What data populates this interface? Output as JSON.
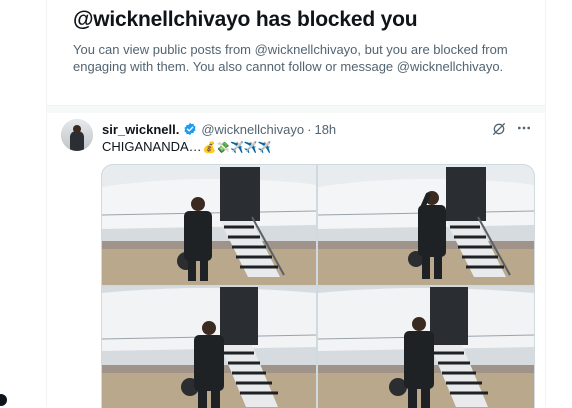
{
  "block_notice": {
    "title": "@wicknellchivayo has blocked you",
    "description": "You can view public posts from @wicknellchivayo, but you are blocked from engaging with them. You also cannot follow or message @wicknellchivayo."
  },
  "tweet": {
    "author_name": "sir_wicknell.",
    "handle": "@wicknellchivayo",
    "separator": "·",
    "timestamp": "18h",
    "text": "CHIGANANDA…",
    "emojis": "💰💸✈️✈️✈️",
    "verified_color": "#1d9bf0"
  },
  "icons": {
    "verified": "verified-badge-icon",
    "grok": "grok-icon",
    "more": "more-options-icon"
  }
}
